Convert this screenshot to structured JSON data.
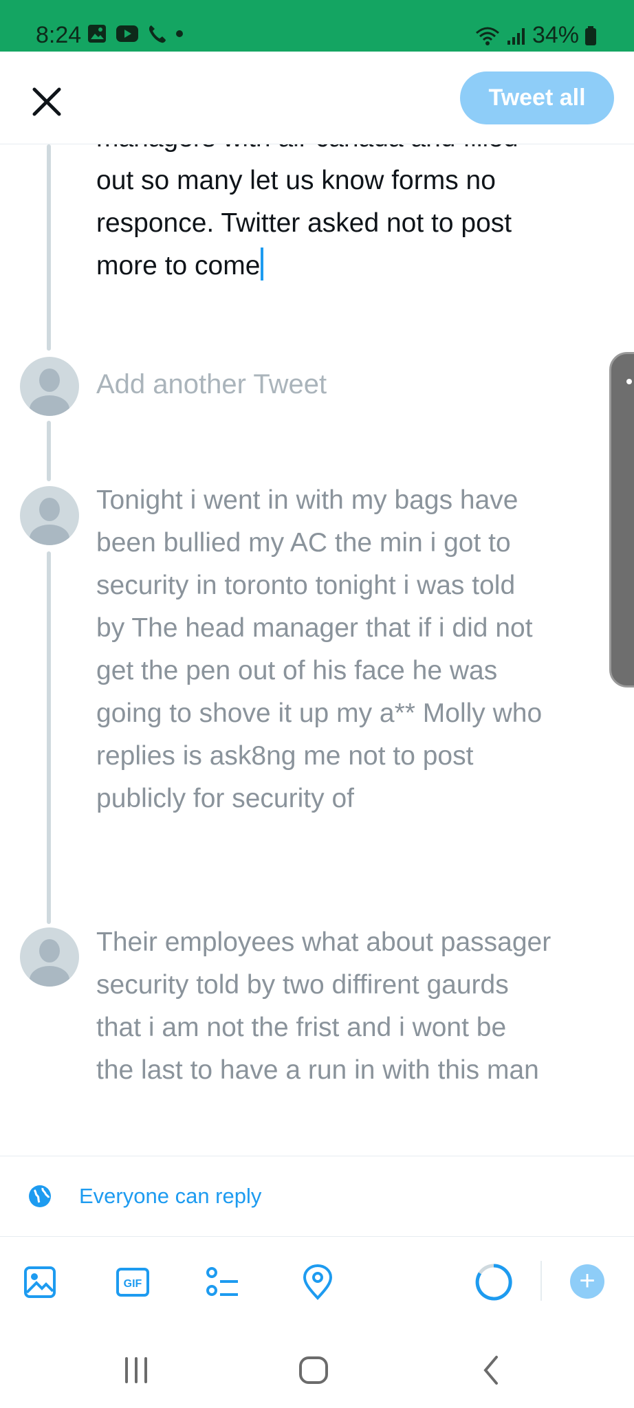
{
  "status_bar": {
    "time": "8:24",
    "battery": "34%",
    "left_icons": [
      "gallery-icon",
      "youtube-icon",
      "phone-icon",
      "dot-icon"
    ],
    "right_icons": [
      "wifi-icon",
      "signal-icon",
      "battery-icon"
    ]
  },
  "header": {
    "tweet_all_label": "Tweet all"
  },
  "thread": {
    "current_tweet_lines": [
      "managers with air canada and filled",
      "out so many let us know forms no",
      "responce. Twitter asked not to post",
      "more to come"
    ],
    "add_placeholder": "Add another Tweet",
    "tweets": [
      {
        "lines": [
          "Tonight i went in with my bags have",
          "been bullied my AC the min i got to",
          "security in toronto tonight i was told",
          "by The head manager that if i did not",
          "get the pen out of his face he was",
          "going to shove it up my a** Molly who",
          "replies is ask8ng me not to post",
          "publicly for security of"
        ]
      },
      {
        "lines": [
          "Their employees what about passager",
          "security told by two diffirent gaurds",
          "that i am not the frist and i wont be",
          "the last to have a run in with this man"
        ]
      }
    ]
  },
  "reply_setting": {
    "label": "Everyone can reply"
  },
  "toolbar": {
    "tools": [
      "image-icon",
      "gif-icon",
      "poll-icon",
      "location-icon"
    ],
    "add_label": "+"
  },
  "colors": {
    "status_bar": "#14a562",
    "accent": "#1d9bf0",
    "accent_disabled": "#8ecdf8"
  }
}
